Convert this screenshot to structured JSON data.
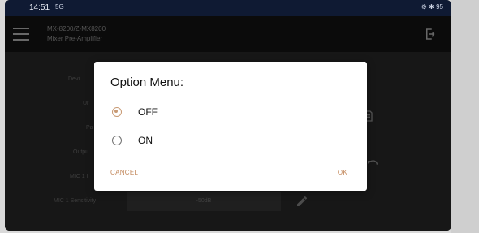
{
  "status_bar": {
    "time": "14:51",
    "signal_text": "5G",
    "right_icons_text": "⚙ ✱ 95"
  },
  "header": {
    "title_line1": "MX-8200/Z-MX8200",
    "title_line2": "Mixer Pre-Amplifier"
  },
  "background": {
    "labels": [
      "Devi",
      "Ur",
      "Pa",
      "Outpu",
      "MIC 1 I",
      "MIC 1 Sensitivity"
    ],
    "sensitivity_value": "-50dB"
  },
  "dialog": {
    "title": "Option Menu:",
    "options": [
      {
        "label": "OFF",
        "selected": true
      },
      {
        "label": "ON",
        "selected": false
      }
    ],
    "cancel_label": "CANCEL",
    "ok_label": "OK"
  },
  "colors": {
    "accent": "#c2875a",
    "status_bar_bg": "#0f1a33",
    "dialog_bg": "#ffffff"
  }
}
